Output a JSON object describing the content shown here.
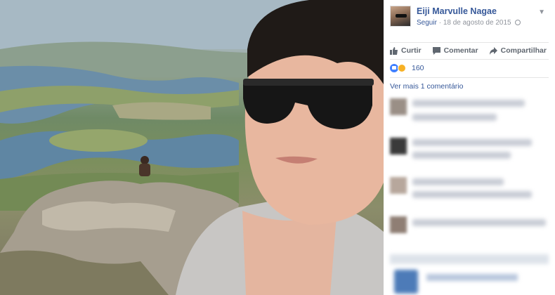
{
  "post": {
    "author_name": "Eiji Marvulle Nagae",
    "follow_label": "Seguir",
    "separator": "·",
    "date": "18 de agosto de 2015",
    "privacy_icon": "globe-icon",
    "options_icon": "chevron-down-icon"
  },
  "actions": [
    {
      "label": "Curtir",
      "icon": "thumbs-up-icon"
    },
    {
      "label": "Comentar",
      "icon": "speech-bubble-icon"
    },
    {
      "label": "Compartilhar",
      "icon": "share-arrow-icon"
    }
  ],
  "reactions": {
    "icons": [
      "like-reaction-icon",
      "haha-reaction-icon"
    ],
    "count": "160"
  },
  "comments": {
    "view_more_label": "Ver mais 1 comentário"
  },
  "colors": {
    "link": "#365899",
    "meta": "#90949c",
    "action_text": "#606770",
    "like_blue": "#4080ff"
  }
}
